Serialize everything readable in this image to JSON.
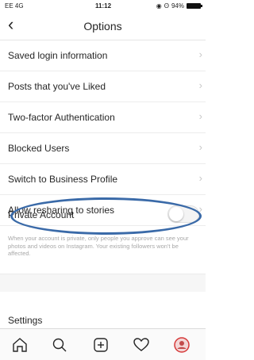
{
  "status_bar": {
    "carrier": "EE 4G",
    "time": "11:12",
    "battery": "94%"
  },
  "header": {
    "title": "Options"
  },
  "rows": [
    {
      "label": "Saved login information"
    },
    {
      "label": "Posts that you've Liked"
    },
    {
      "label": "Two-factor Authentication"
    },
    {
      "label": "Blocked Users"
    },
    {
      "label": "Switch to Business Profile"
    },
    {
      "label": "Allow resharing to stories",
      "value": "On"
    },
    {
      "label": "Private Account"
    }
  ],
  "private_description": "When your account is private, only people you approve can see your photos and videos on Instagram. Your existing followers won't be affected.",
  "settings_heading": "Settings",
  "icons": {
    "back": "chevron-left-icon",
    "tabs": [
      "home-icon",
      "search-icon",
      "add-post-icon",
      "heart-icon",
      "profile-avatar-icon"
    ]
  },
  "colors": {
    "highlight_ellipse": "#3a6aa8"
  }
}
